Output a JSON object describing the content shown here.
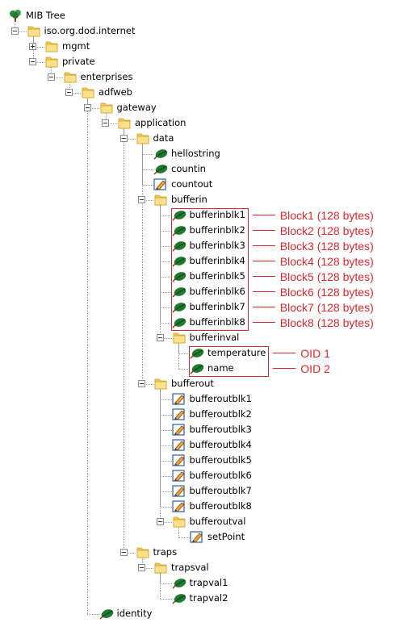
{
  "tree": {
    "nodes": [
      {
        "label": "MIB Tree",
        "icon": "tree",
        "depth": 0
      },
      {
        "label": "iso.org.dod.internet",
        "icon": "folder",
        "depth": 1,
        "expander": "minus"
      },
      {
        "label": "mgmt",
        "icon": "folder",
        "depth": 2,
        "expander": "plus"
      },
      {
        "label": "private",
        "icon": "folder",
        "depth": 2,
        "expander": "minus"
      },
      {
        "label": "enterprises",
        "icon": "folder",
        "depth": 3,
        "expander": "minus"
      },
      {
        "label": "adfweb",
        "icon": "folder",
        "depth": 4,
        "expander": "minus"
      },
      {
        "label": "gateway",
        "icon": "folder",
        "depth": 5,
        "expander": "minus"
      },
      {
        "label": "application",
        "icon": "folder",
        "depth": 6,
        "expander": "minus"
      },
      {
        "label": "data",
        "icon": "folder",
        "depth": 7,
        "expander": "minus"
      },
      {
        "label": "hellostring",
        "icon": "leaf",
        "depth": 8
      },
      {
        "label": "countin",
        "icon": "leaf",
        "depth": 8
      },
      {
        "label": "countout",
        "icon": "writable",
        "depth": 8
      },
      {
        "label": "bufferin",
        "icon": "folder",
        "depth": 8,
        "expander": "minus"
      },
      {
        "label": "bufferinblk1",
        "icon": "leaf",
        "depth": 9
      },
      {
        "label": "bufferinblk2",
        "icon": "leaf",
        "depth": 9
      },
      {
        "label": "bufferinblk3",
        "icon": "leaf",
        "depth": 9
      },
      {
        "label": "bufferinblk4",
        "icon": "leaf",
        "depth": 9
      },
      {
        "label": "bufferinblk5",
        "icon": "leaf",
        "depth": 9
      },
      {
        "label": "bufferinblk6",
        "icon": "leaf",
        "depth": 9
      },
      {
        "label": "bufferinblk7",
        "icon": "leaf",
        "depth": 9
      },
      {
        "label": "bufferinblk8",
        "icon": "leaf",
        "depth": 9
      },
      {
        "label": "bufferinval",
        "icon": "folder",
        "depth": 9,
        "expander": "minus"
      },
      {
        "label": "temperature",
        "icon": "leaf",
        "depth": 10
      },
      {
        "label": "name",
        "icon": "leaf",
        "depth": 10
      },
      {
        "label": "bufferout",
        "icon": "folder",
        "depth": 8,
        "expander": "minus"
      },
      {
        "label": "bufferoutblk1",
        "icon": "writable",
        "depth": 9
      },
      {
        "label": "bufferoutblk2",
        "icon": "writable",
        "depth": 9
      },
      {
        "label": "bufferoutblk3",
        "icon": "writable",
        "depth": 9
      },
      {
        "label": "bufferoutblk4",
        "icon": "writable",
        "depth": 9
      },
      {
        "label": "bufferoutblk5",
        "icon": "writable",
        "depth": 9
      },
      {
        "label": "bufferoutblk6",
        "icon": "writable",
        "depth": 9
      },
      {
        "label": "bufferoutblk7",
        "icon": "writable",
        "depth": 9
      },
      {
        "label": "bufferoutblk8",
        "icon": "writable",
        "depth": 9
      },
      {
        "label": "bufferoutval",
        "icon": "folder",
        "depth": 9,
        "expander": "minus"
      },
      {
        "label": "setPoint",
        "icon": "writable",
        "depth": 10
      },
      {
        "label": "traps",
        "icon": "folder",
        "depth": 7,
        "expander": "minus"
      },
      {
        "label": "trapsval",
        "icon": "folder",
        "depth": 8,
        "expander": "minus"
      },
      {
        "label": "trapval1",
        "icon": "leaf",
        "depth": 9
      },
      {
        "label": "trapval2",
        "icon": "leaf",
        "depth": 9
      },
      {
        "label": "identity",
        "icon": "leaf",
        "depth": 5
      }
    ]
  },
  "annotations": [
    {
      "text": "Block1 (128 bytes)",
      "target": 13
    },
    {
      "text": "Block2 (128 bytes)",
      "target": 14
    },
    {
      "text": "Block3 (128 bytes)",
      "target": 15
    },
    {
      "text": "Block4 (128 bytes)",
      "target": 16
    },
    {
      "text": "Block5 (128 bytes)",
      "target": 17
    },
    {
      "text": "Block6 (128 bytes)",
      "target": 18
    },
    {
      "text": "Block7 (128 bytes)",
      "target": 19
    },
    {
      "text": "Block8 (128 bytes)",
      "target": 20
    },
    {
      "text": "OID 1",
      "target": 22
    },
    {
      "text": "OID 2",
      "target": 23
    }
  ],
  "highlight_groups": [
    {
      "from": 13,
      "to": 20
    },
    {
      "from": 22,
      "to": 23
    }
  ],
  "colors": {
    "annotation": "#e0262a",
    "folder": "#f2c94c",
    "leaf": "#1e7a2e",
    "writable": "#2a5db0"
  }
}
